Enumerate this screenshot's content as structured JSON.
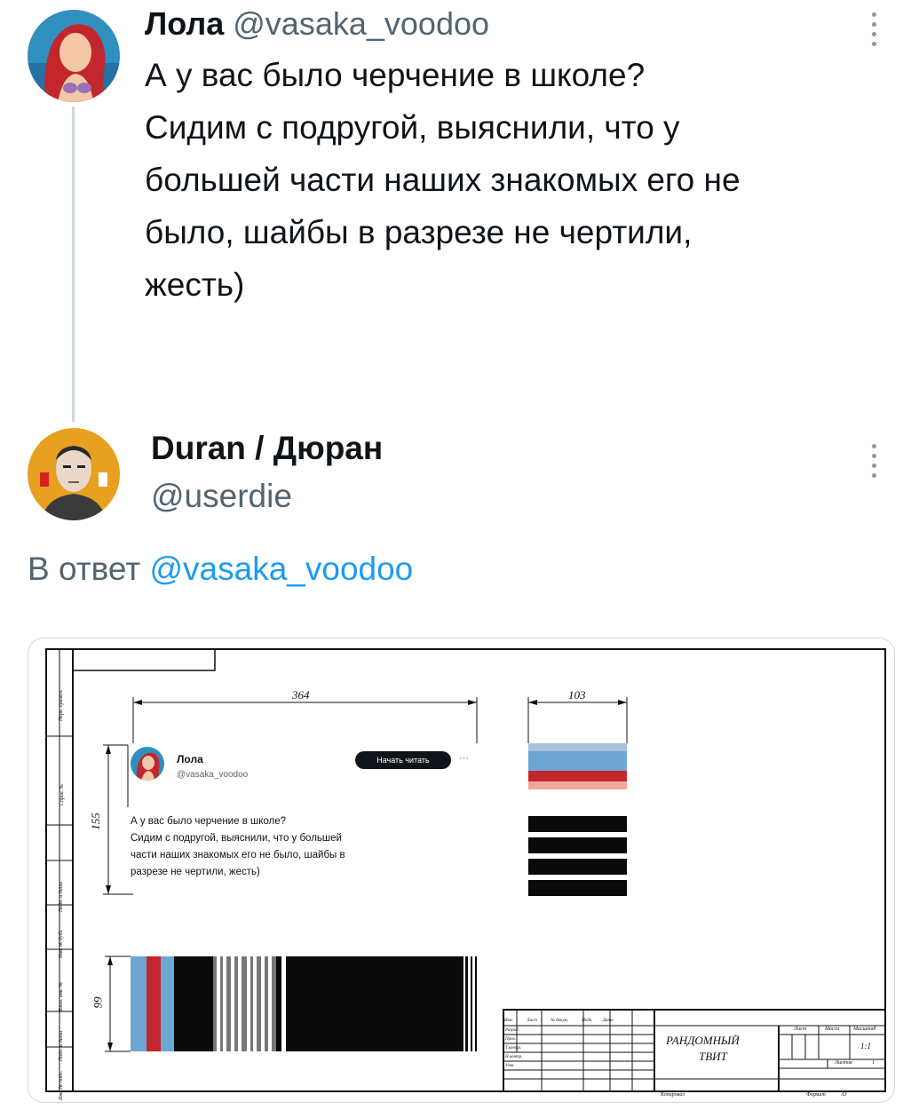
{
  "tweet1": {
    "name": "Лола",
    "handle": "@vasaka_voodoo",
    "lines": [
      "А у вас было черчение в школе?",
      "Сидим с подругой, выяснили, что у",
      "большей части наших знакомых его не",
      "было, шайбы в разрезе не чертили,",
      "жесть)"
    ]
  },
  "tweet2": {
    "name": "Duran / Дюран",
    "handle": "@userdie",
    "reply_prefix": "В ответ",
    "reply_mention": "@vasaka_voodoo"
  },
  "drawing": {
    "dim_width": "364",
    "dim_height": "155",
    "dim_flag_width": "103",
    "dim_bar_height": "99",
    "mini_name": "Лола",
    "mini_handle": "@vasaka_voodoo",
    "mini_button": "Начать читать",
    "mini_lines": [
      "А у вас было черчение в школе?",
      "Сидим с подругой, выяснили, что у большей",
      "части наших знакомых его не было, шайбы в",
      "разрезе не чертили, жесть)"
    ],
    "title_line1": "РАНДОМНЫЙ",
    "title_line2": "ТВИТ",
    "scale": "1:1",
    "sheet_label": "Лист",
    "mass_label": "Масса",
    "scale_label": "Масштаб",
    "sheets_label": "Листов",
    "sheets_value": "1",
    "copied_label": "Копировал",
    "format_label": "Формат",
    "format_value": "А3",
    "row_labels": [
      "Изм.",
      "Лист",
      "№ докум.",
      "Подп.",
      "Дата"
    ],
    "stamp_rows": [
      "Разраб.",
      "Пров.",
      "Т.контр.",
      "Н.контр.",
      "Утв."
    ],
    "side_labels": [
      "Перв. примен.",
      "Справ. №",
      "Подп. и дата",
      "Инв. № дубл.",
      "Взам. инв. №",
      "Подп. и дата",
      "Инв. № подл."
    ]
  },
  "colors": {
    "link": "#1d9bf0",
    "handle": "#536471",
    "flag_light_blue": "#a9c3dd",
    "flag_blue": "#6ea6d3",
    "flag_red": "#c0282e",
    "flag_pink": "#f0a79b"
  }
}
